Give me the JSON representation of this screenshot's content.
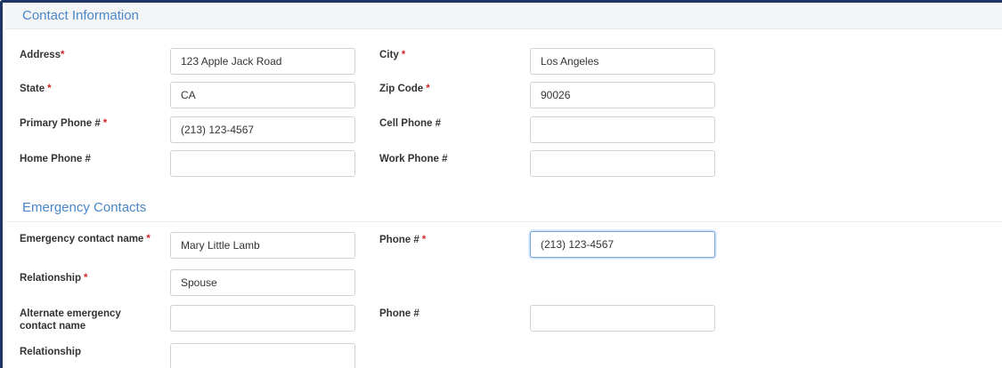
{
  "sections": {
    "contact": {
      "title": "Contact Information"
    },
    "emergency": {
      "title": "Emergency Contacts"
    }
  },
  "required_marker": "*",
  "contact": {
    "address": {
      "label": "Address",
      "required": true,
      "value": "123 Apple Jack Road"
    },
    "city": {
      "label": "City",
      "required": true,
      "value": "Los Angeles"
    },
    "state": {
      "label": "State",
      "required": true,
      "value": "CA"
    },
    "zip": {
      "label": "Zip Code",
      "required": true,
      "value": "90026"
    },
    "primary_phone": {
      "label": "Primary Phone #",
      "required": true,
      "value": "(213) 123-4567"
    },
    "cell_phone": {
      "label": "Cell Phone #",
      "required": false,
      "value": ""
    },
    "home_phone": {
      "label": "Home Phone #",
      "required": false,
      "value": ""
    },
    "work_phone": {
      "label": "Work Phone #",
      "required": false,
      "value": ""
    }
  },
  "emergency": {
    "contact_name": {
      "label": "Emergency contact name",
      "required": true,
      "value": "Mary Little Lamb"
    },
    "phone": {
      "label": "Phone #",
      "required": true,
      "value": "(213) 123-4567",
      "focused": true
    },
    "relationship": {
      "label": "Relationship",
      "required": true,
      "value": "Spouse"
    },
    "alt_contact_name": {
      "label": "Alternate emergency contact name",
      "required": false,
      "value": ""
    },
    "alt_phone": {
      "label": "Phone #",
      "required": false,
      "value": ""
    },
    "alt_relationship": {
      "label": "Relationship",
      "required": false,
      "value": ""
    }
  },
  "colors": {
    "section_title": "#4a86c8",
    "required": "#d02828",
    "frame_border": "#1f3566",
    "focus_ring": "#79a6dd"
  }
}
